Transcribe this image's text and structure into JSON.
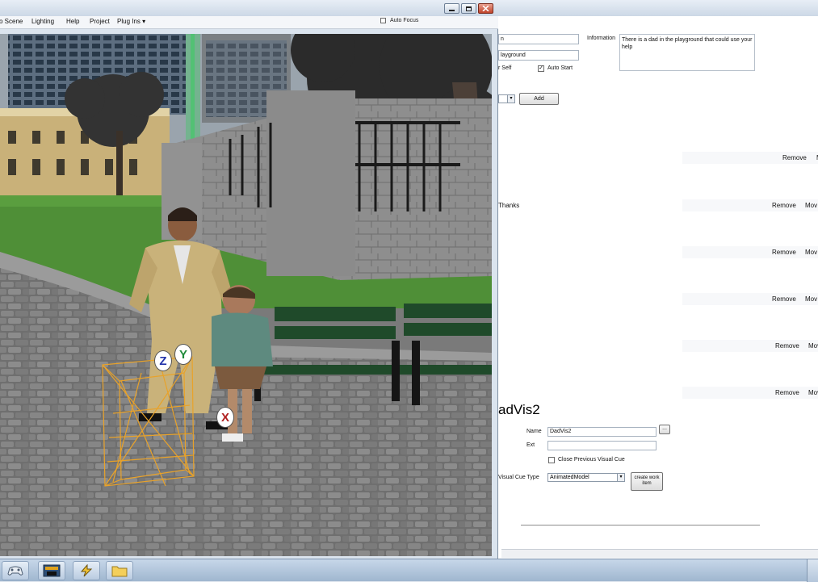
{
  "scene_window": {
    "menu": [
      "o Scene",
      "Lighting",
      "Help",
      "Project",
      "Plug Ins ▾"
    ],
    "auto_focus_label": "Auto Focus",
    "gizmo_labels": {
      "z": "Z",
      "y": "Y",
      "x": "X"
    }
  },
  "editor": {
    "top_field_1": "n",
    "top_field_2": "layground",
    "self_label": "r Self",
    "auto_start_label": "Auto Start",
    "auto_start_checked": "✓",
    "add_label": "Add",
    "information_label": "Information",
    "information_text": "There is a dad in the playground that could use your help",
    "thanks_label": "Thanks",
    "rows": [
      {
        "remove": "Remove",
        "move": "M"
      },
      {
        "remove": "Remove",
        "move": "Mov"
      },
      {
        "remove": "Remove",
        "move": "Mov"
      },
      {
        "remove": "Remove",
        "move": "Mov"
      },
      {
        "remove": "Remove",
        "move": "Mov"
      },
      {
        "remove": "Remove",
        "move": "Mov"
      }
    ],
    "visual_cue": {
      "heading": "adVis2",
      "name_label": "Name",
      "name_value": "DadVis2",
      "browse_label": "...",
      "ext_label": "Ext",
      "ext_value": "",
      "close_prev_label": "Close Previous Visual Cue",
      "type_label": "Visual Cue Type",
      "type_value": "AnimatedModel",
      "create_button_label": "create work item"
    }
  },
  "colors": {
    "gizmo_orange": "#e8a22a",
    "gizmo_green": "#2fd05a",
    "grass": "#4f8f37",
    "bench": "#1f4a2a"
  }
}
